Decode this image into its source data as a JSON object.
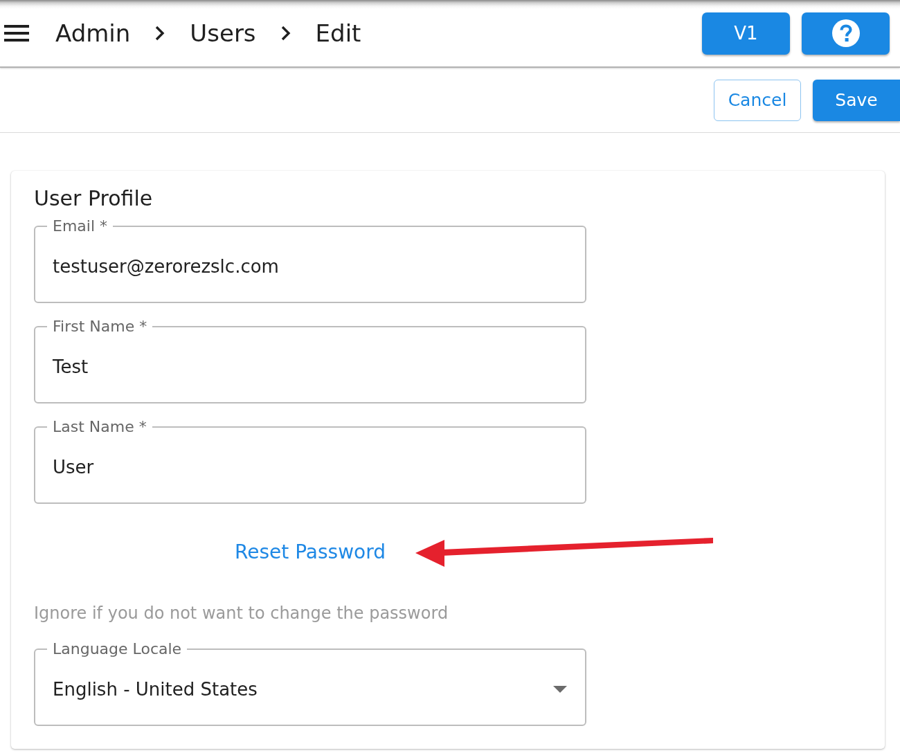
{
  "top_bar": {
    "breadcrumb": [
      {
        "label": "Admin"
      },
      {
        "label": "Users"
      },
      {
        "label": "Edit"
      }
    ],
    "buttons": [
      {
        "kind": "text",
        "label": "V1"
      },
      {
        "kind": "help"
      }
    ]
  },
  "action_bar": {
    "buttons": [
      {
        "kind": "outlined",
        "label": "Cancel"
      },
      {
        "kind": "filled",
        "label": "Save"
      }
    ]
  },
  "card": {
    "title": "User Profile",
    "items": [
      {
        "kind": "text_field",
        "label": "Email *",
        "value": "testuser@zerorezslc.com"
      },
      {
        "kind": "text_field",
        "label": "First Name *",
        "value": "Test"
      },
      {
        "kind": "text_field",
        "label": "Last Name *",
        "value": "User"
      },
      {
        "kind": "link",
        "label": "Reset Password"
      },
      {
        "kind": "helper_text",
        "text": "Ignore if you do not want to change the password"
      },
      {
        "kind": "select_field",
        "label": "Language Locale",
        "value": "English - United States"
      }
    ]
  }
}
